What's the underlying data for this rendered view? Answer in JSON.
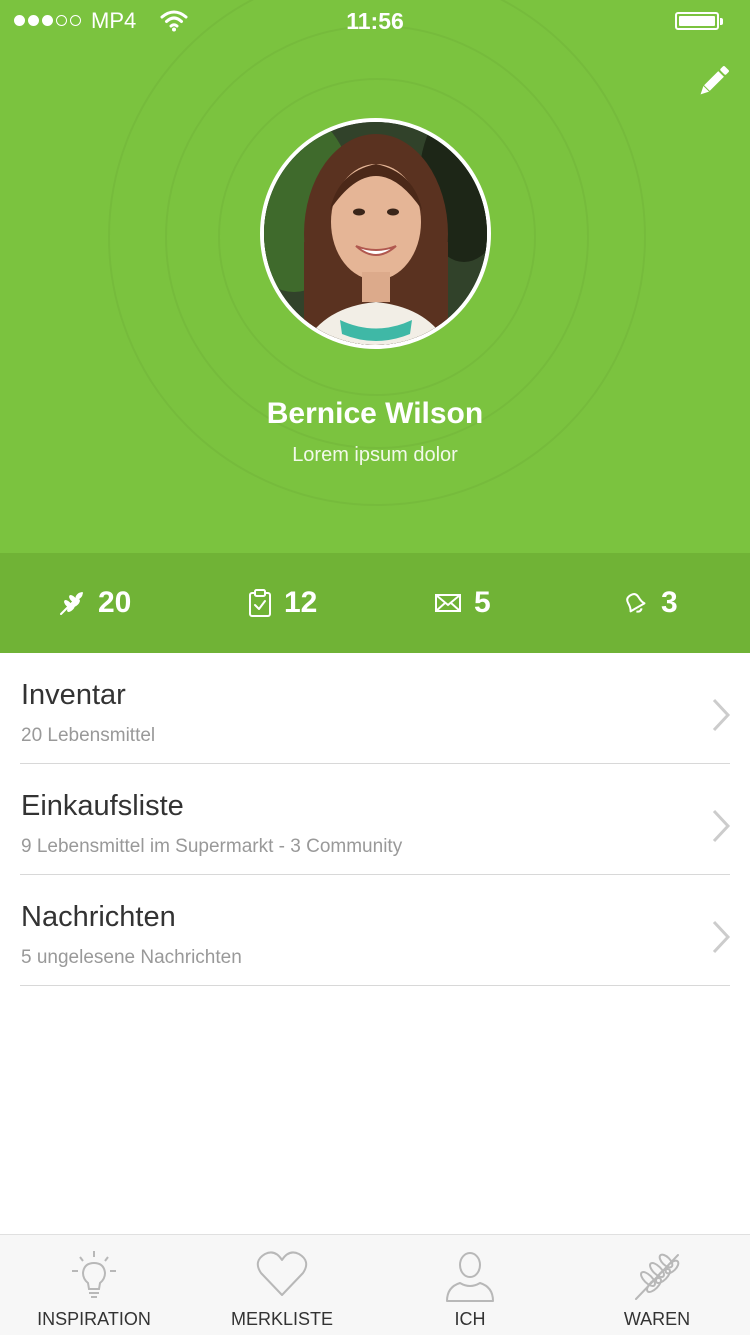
{
  "status_bar": {
    "carrier": "MP4",
    "time": "11:56"
  },
  "profile": {
    "name": "Bernice Wilson",
    "subtitle": "Lorem ipsum dolor"
  },
  "stats": [
    {
      "icon": "wheat-icon",
      "value": "20"
    },
    {
      "icon": "clipboard-check-icon",
      "value": "12"
    },
    {
      "icon": "envelope-icon",
      "value": "5"
    },
    {
      "icon": "bell-icon",
      "value": "3"
    }
  ],
  "list": [
    {
      "title": "Inventar",
      "subtitle": "20 Lebensmittel"
    },
    {
      "title": "Einkaufsliste",
      "subtitle": "9 Lebensmittel im Supermarkt - 3 Community"
    },
    {
      "title": "Nachrichten",
      "subtitle": "5 ungelesene Nachrichten"
    }
  ],
  "tabs": [
    {
      "icon": "lightbulb-icon",
      "label": "INSPIRATION"
    },
    {
      "icon": "heart-icon",
      "label": "MERKLISTE"
    },
    {
      "icon": "person-icon",
      "label": "ICH"
    },
    {
      "icon": "wheat-icon",
      "label": "WAREN"
    }
  ],
  "colors": {
    "brand_green": "#7bc33f",
    "stats_green": "#70b336",
    "text_dark": "#333333",
    "text_muted": "#999999"
  }
}
